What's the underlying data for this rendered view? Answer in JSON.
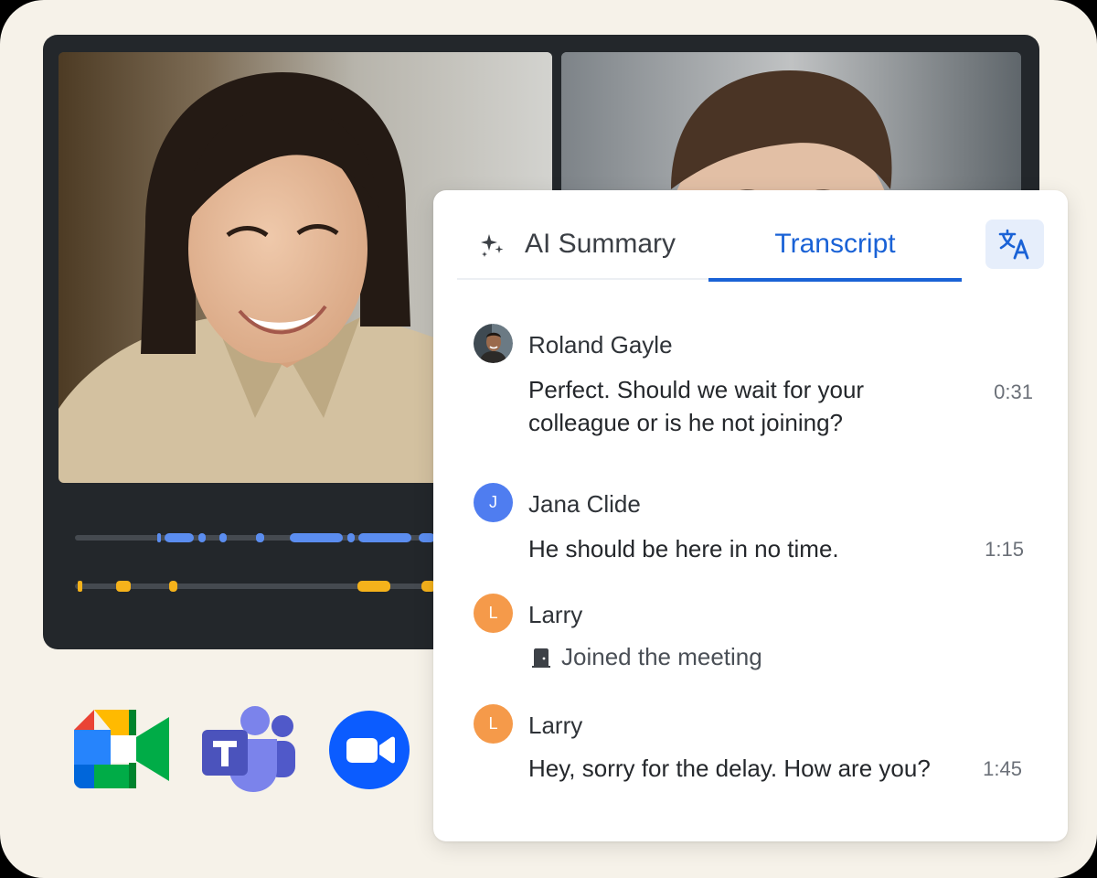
{
  "panel": {
    "tabs": [
      {
        "label": "AI Summary",
        "icon": "sparkle-icon",
        "active": false
      },
      {
        "label": "Transcript",
        "active": true
      }
    ],
    "translate_icon": "translate-icon",
    "accent_color": "#1a62d6"
  },
  "transcript": [
    {
      "speaker": "Roland Gayle",
      "avatar": "photo",
      "text_line1": "Perfect. Should we wait for your",
      "text_line2": "colleague or is he not joining?",
      "time": "0:31"
    },
    {
      "speaker": "Jana Clide",
      "avatar_initial": "J",
      "avatar_color": "#4f7df0",
      "text": "He should be here in no time.",
      "time": "1:15"
    },
    {
      "speaker": "Larry",
      "avatar_initial": "L",
      "avatar_color": "#f59a4a",
      "event": "Joined the meeting",
      "event_icon": "door-icon"
    },
    {
      "speaker": "Larry",
      "avatar_initial": "L",
      "avatar_color": "#f59a4a",
      "text": "Hey, sorry for the delay. How are you?",
      "time": "1:45"
    }
  ],
  "integrations": [
    "google-meet-logo",
    "microsoft-teams-logo",
    "zoom-logo"
  ],
  "timeline_colors": {
    "speaker_1": "#5b8def",
    "speaker_2": "#f5b21b",
    "track": "#4a4f55"
  }
}
